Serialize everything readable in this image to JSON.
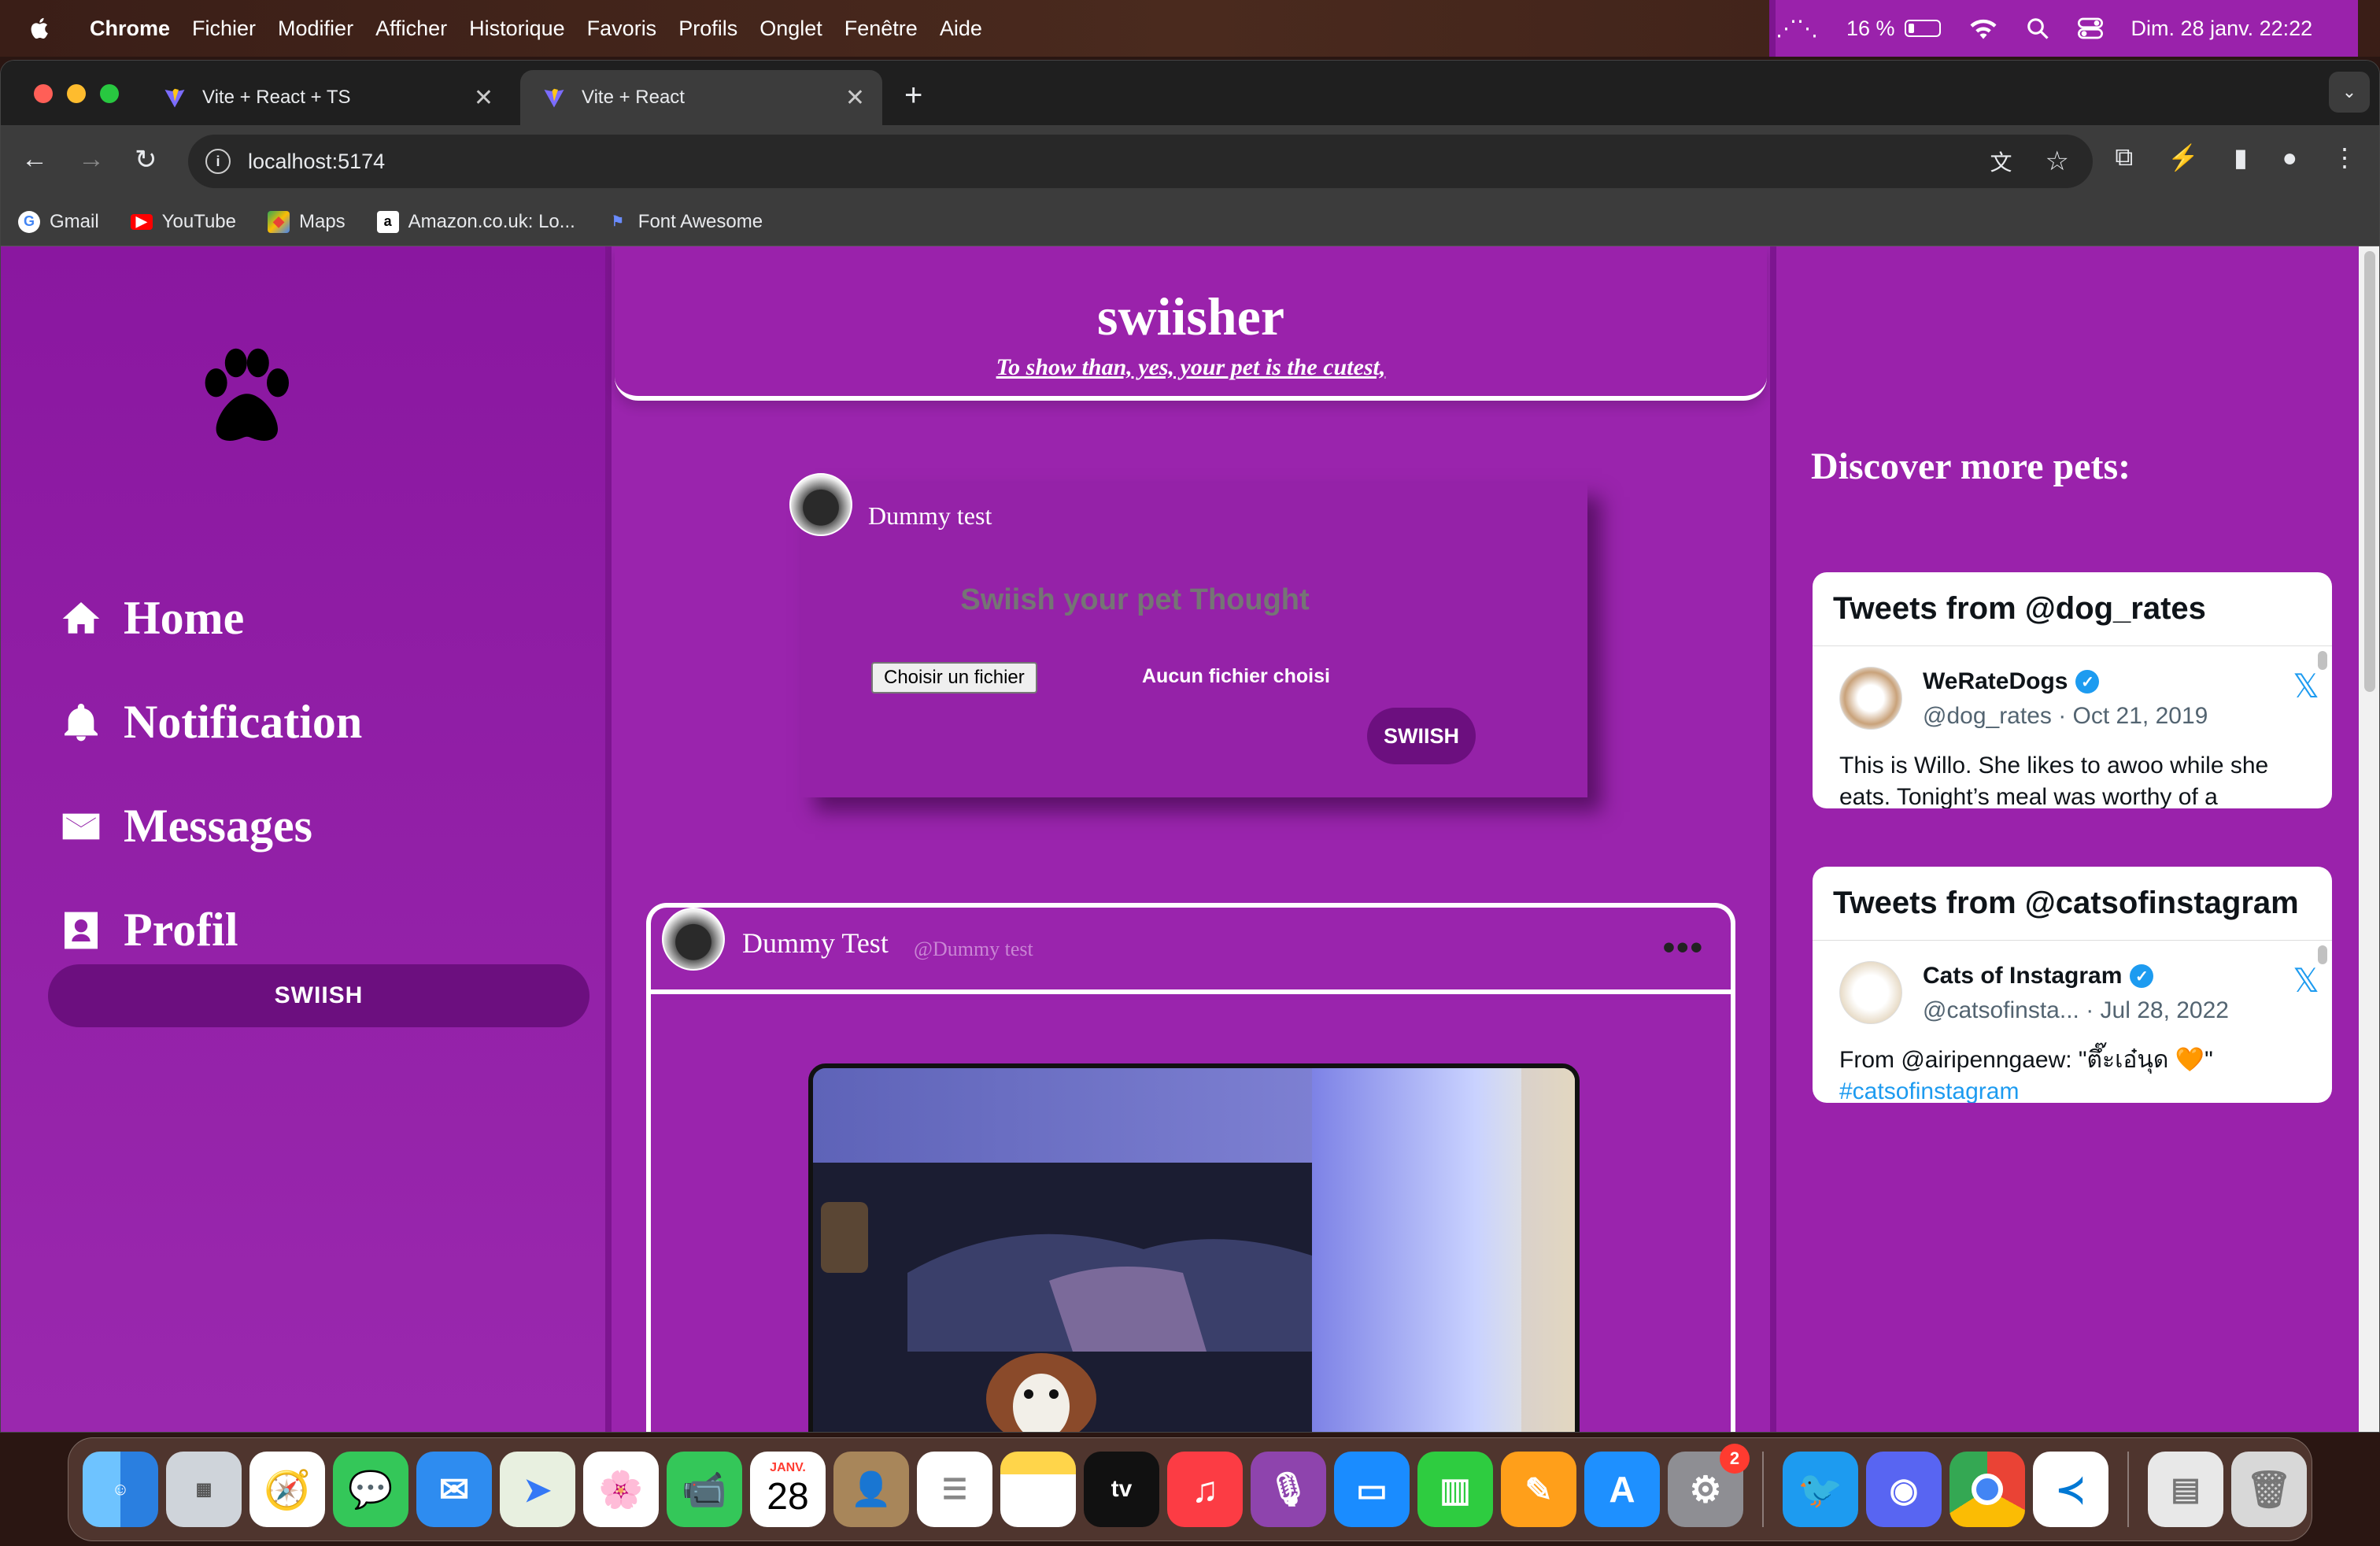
{
  "menubar": {
    "app": "Chrome",
    "items": [
      "Fichier",
      "Modifier",
      "Afficher",
      "Historique",
      "Favoris",
      "Profils",
      "Onglet",
      "Fenêtre",
      "Aide"
    ],
    "battery": "16 %",
    "datetime": "Dim. 28 janv. 22:22"
  },
  "browser": {
    "tabs": [
      {
        "title": "Vite + React + TS",
        "active": false
      },
      {
        "title": "Vite + React",
        "active": true
      }
    ],
    "url": "localhost:5174",
    "bookmarks": [
      {
        "label": "Gmail",
        "icon": "google-icon"
      },
      {
        "label": "YouTube",
        "icon": "youtube-icon"
      },
      {
        "label": "Maps",
        "icon": "maps-icon"
      },
      {
        "label": "Amazon.co.uk: Lo...",
        "icon": "amazon-icon"
      },
      {
        "label": "Font Awesome",
        "icon": "flag-icon"
      }
    ]
  },
  "sidebar": {
    "logo": "paw-icon",
    "nav": [
      {
        "label": "Home",
        "icon": "home-icon"
      },
      {
        "label": "Notification",
        "icon": "bell-icon"
      },
      {
        "label": "Messages",
        "icon": "envelope-icon"
      },
      {
        "label": "Profil",
        "icon": "user-icon"
      }
    ],
    "swiish_button": "SWIISH"
  },
  "header": {
    "title": "swiisher",
    "tagline": "To show than, yes, your pet is the cutest,"
  },
  "composer": {
    "username": "Dummy test",
    "placeholder": "Swiish your pet Thought",
    "file_button": "Choisir un fichier",
    "file_status": "Aucun fichier choisi",
    "submit": "SWIISH"
  },
  "post": {
    "name": "Dummy Test",
    "handle": "@Dummy test",
    "menu": "•••"
  },
  "right": {
    "title": "Discover more pets:",
    "embeds": [
      {
        "header": "Tweets from @dog_rates",
        "name": "WeRateDogs",
        "meta": "@dog_rates · Oct 21, 2019",
        "text": "This is Willo. She likes to awoo while she eats. Tonight’s meal was worthy of a"
      },
      {
        "header": "Tweets from @catsofinstagram",
        "name": "Cats of Instagram",
        "meta": "@catsofinsta... · Jul 28, 2022",
        "text": "From @airipenngaew: \"ตึ๊ะเอ๋นุด 🧡\"",
        "link": "#catsofinstagram"
      }
    ]
  },
  "dock": {
    "calendar_month": "JANV.",
    "calendar_day": "28",
    "settings_badge": "2",
    "apps": [
      "Finder",
      "Launchpad",
      "Safari",
      "Messages",
      "Mail",
      "Maps",
      "Photos",
      "FaceTime",
      "Calendar",
      "Contacts",
      "Reminders",
      "Notes",
      "TV",
      "Music",
      "Podcasts",
      "Keynote",
      "Numbers",
      "Pages",
      "App Store",
      "System Settings",
      "Twitter",
      "Discord",
      "Chrome",
      "VS Code",
      "Documents",
      "Trash"
    ],
    "colors": {
      "accent": "#9522a8",
      "dark_button": "#6c0f7f",
      "twitter_blue": "#1d9bf0"
    }
  }
}
